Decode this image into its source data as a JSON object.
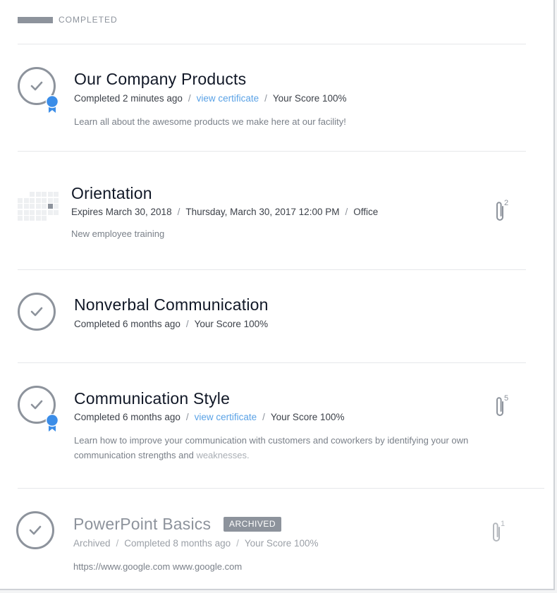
{
  "section": {
    "label": "COMPLETED"
  },
  "items": [
    {
      "title": "Our Company Products",
      "status": "Completed 2 minutes ago",
      "certificate": "view certificate",
      "score": "Your Score 100%",
      "description": "Learn all about the awesome products we make here at our facility!",
      "icon": "check-circle-icon",
      "badge": "ribbon-badge-icon"
    },
    {
      "title": "Orientation",
      "expires": "Expires March 30, 2018",
      "datetime": "Thursday, March 30, 2017 12:00 PM",
      "location": "Office",
      "description": "New employee training",
      "icon": "calendar-icon",
      "attachments": "2"
    },
    {
      "title": "Nonverbal Communication",
      "status": "Completed 6 months ago",
      "score": "Your Score 100%",
      "icon": "check-circle-icon"
    },
    {
      "title": "Communication Style",
      "status": "Completed 6 months ago",
      "certificate": "view certificate",
      "score": "Your Score 100%",
      "description_main": "Learn how to improve your communication with customers and coworkers by identifying your own communication strengths and",
      "description_fade": "weaknesses.",
      "icon": "check-circle-icon",
      "badge": "ribbon-badge-icon",
      "attachments": "5"
    },
    {
      "title": "PowerPoint Basics",
      "tag": "ARCHIVED",
      "archived": "Archived",
      "status": "Completed 8 months ago",
      "score": "Your Score 100%",
      "description": "https://www.google.com www.google.com",
      "icon": "check-circle-icon",
      "attachments": "1"
    }
  ],
  "colors": {
    "accent": "#5aa2e6",
    "badge": "#3b8de8",
    "muted": "#8d939c",
    "text": "#111827"
  }
}
